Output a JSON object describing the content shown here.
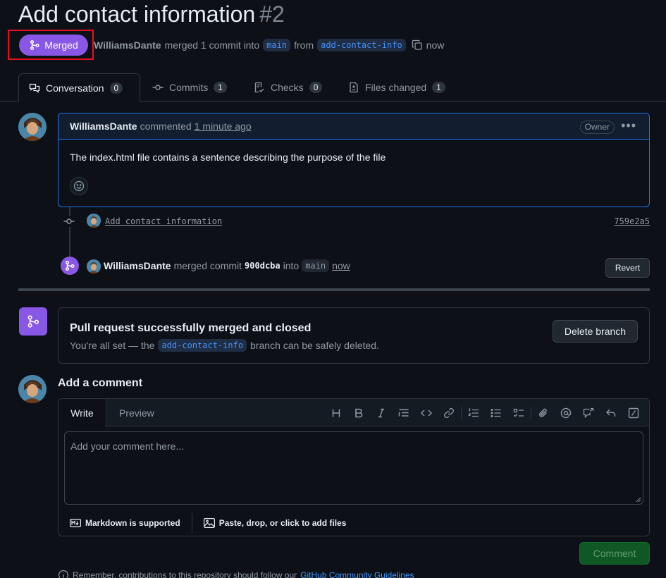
{
  "pr": {
    "title": "Add contact information",
    "number": "#2",
    "state": "Merged",
    "author": "WilliamsDante",
    "merge_text": "merged 1 commit into",
    "base_branch": "main",
    "from_text": "from",
    "head_branch": "add-contact-info",
    "time": "now"
  },
  "tabs": [
    {
      "label": "Conversation",
      "count": "0"
    },
    {
      "label": "Commits",
      "count": "1"
    },
    {
      "label": "Checks",
      "count": "0"
    },
    {
      "label": "Files changed",
      "count": "1"
    }
  ],
  "comment": {
    "author": "WilliamsDante",
    "action": "commented",
    "time": "1 minute ago",
    "role": "Owner",
    "body": "The index.html file contains a sentence describing the purpose of the file"
  },
  "commit": {
    "message": "Add contact information",
    "sha": "759e2a5"
  },
  "merge_event": {
    "author": "WilliamsDante",
    "action": "merged commit",
    "sha": "900dcba",
    "into": "into",
    "branch": "main",
    "time": "now",
    "revert_label": "Revert"
  },
  "merge_box": {
    "title": "Pull request successfully merged and closed",
    "sub_prefix": "You're all set — the",
    "branch": "add-contact-info",
    "sub_suffix": "branch can be safely deleted.",
    "delete_label": "Delete branch"
  },
  "new_comment": {
    "heading": "Add a comment",
    "tab_write": "Write",
    "tab_preview": "Preview",
    "placeholder": "Add your comment here...",
    "markdown_note": "Markdown is supported",
    "attach_note": "Paste, drop, or click to add files",
    "submit_label": "Comment"
  },
  "footer": {
    "text": "Remember, contributions to this repository should follow our",
    "link": "GitHub Community Guidelines"
  },
  "colors": {
    "merged_purple": "#8957e5",
    "link_blue": "#4493f8",
    "highlight_red": "#e5101d",
    "comment_green": "#105823"
  }
}
